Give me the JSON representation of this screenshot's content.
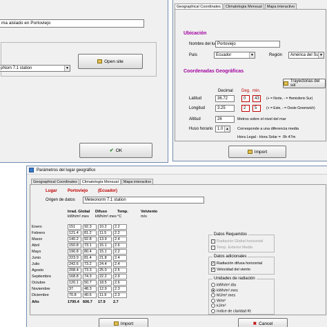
{
  "win_a": {
    "title_field": "ma aislado  en  Portoviejo",
    "select_value": "pNom 7.1 station",
    "open_btn": "Open site",
    "ok_btn": "OK"
  },
  "win_b": {
    "tabs": [
      "Geographical Coordinates",
      "Climatología Mensual",
      "Mapa interactivo"
    ],
    "section1": "Ubicación",
    "section2": "Coordenadas Geográficas",
    "name_label": "Nombre del lugar",
    "name_value": "Portoviejo",
    "country_label": "País",
    "country_value": "Ecuador",
    "region_label": "Región",
    "region_value": "América del Sur",
    "col_decimal": "Decimal",
    "col_deg": "Deg.",
    "col_min": "min.",
    "lat_label": "Latitud",
    "lat_dec": "36.72",
    "lat_deg": "0",
    "lat_min": "43",
    "lat_note": "(+ = Norte, - = Hemisferio Sur)",
    "lon_label": "Longitud",
    "lon_dec": "3.25",
    "lon_deg": "2",
    "lon_min": "5",
    "lon_note": "(+ = Este, - = Oeste Greenwich)",
    "alt_label": "Altitud",
    "alt_value": "26",
    "alt_note": "Metros sobre el nivel del mar",
    "tz_label": "Huso horario",
    "tz_value": "1.0",
    "tz_note": "Corresponde a una diferencia media",
    "solar_label": "Hora Legal - Hora Solar =",
    "solar_value": "0h 47m",
    "traj_btn": "Trayectorias del sol",
    "import_btn": "Import"
  },
  "win_c": {
    "title": "Parámetros del lugar geográfico",
    "tabs": [
      "Geographical Coordinates",
      "Climatología Mensual",
      "Mapa interactivo"
    ],
    "site_label": "Lugar",
    "site_value": "Portoviejo",
    "site_country": "(Ecuador)",
    "origin_label": "Origen de datos",
    "origin_value": "Meteonorm 7.1 station",
    "headers": {
      "ghi": "Irrad. Global",
      "ghi_unit": "kWh/m².mes",
      "dif": "Difuso",
      "dif_unit": "kWh/m².mes",
      "temp": "Temp.",
      "temp_unit": "°C",
      "wind": "Velviento",
      "wind_unit": "m/s"
    },
    "rows": [
      [
        "Enero",
        "151",
        "92.3",
        "10.2",
        "2.2"
      ],
      [
        "Febrero",
        "121.4",
        "81.2",
        "11.5",
        "2.2"
      ],
      [
        "Marzo",
        "140.2",
        "92.8",
        "13.9",
        "2.4"
      ],
      [
        "Abril",
        "150.8",
        "73.1",
        "15.1",
        "2.6"
      ],
      [
        "Mayo",
        "196.8",
        "80.4",
        "15.1",
        "2.2"
      ],
      [
        "Junio",
        "223.9",
        "81.4",
        "21.8",
        "2.4"
      ],
      [
        "Julio",
        "242.6",
        "73.2",
        "24.4",
        "2.4"
      ],
      [
        "Agosto",
        "208.4",
        "73.3",
        "25.0",
        "2.5"
      ],
      [
        "Septiembre",
        "168.8",
        "74.3",
        "22.2",
        "2.9"
      ],
      [
        "Octubre",
        "120.1",
        "50.7",
        "18.5",
        "2.6"
      ],
      [
        "Noviembre",
        "37.",
        "48.3",
        "12.9",
        "2.3"
      ],
      [
        "Diciembre",
        "70.8",
        "40.6",
        "11.9",
        "2.3"
      ]
    ],
    "total_label": "Año",
    "totals": [
      "1700.4",
      "606.7",
      "17.9",
      "2.7"
    ],
    "req_title": "Datos Requeridos",
    "req_items": [
      "Radiación Global horizontal",
      "Temp. Exterior Media"
    ],
    "extra_title": "Datos adicionales",
    "extra_items": [
      "Radiación difusa horizontal",
      "Velocidad del viento"
    ],
    "units_title": "Unidades de radiación",
    "units_items": [
      "kWh/m².día",
      "kWh/m².mes",
      "MJ/m².mes",
      "W/m²",
      "kJ/m²",
      "índice de claridad Kt"
    ],
    "units_selected": 1,
    "import_btn": "Import",
    "cancel_btn": "Cancel"
  }
}
